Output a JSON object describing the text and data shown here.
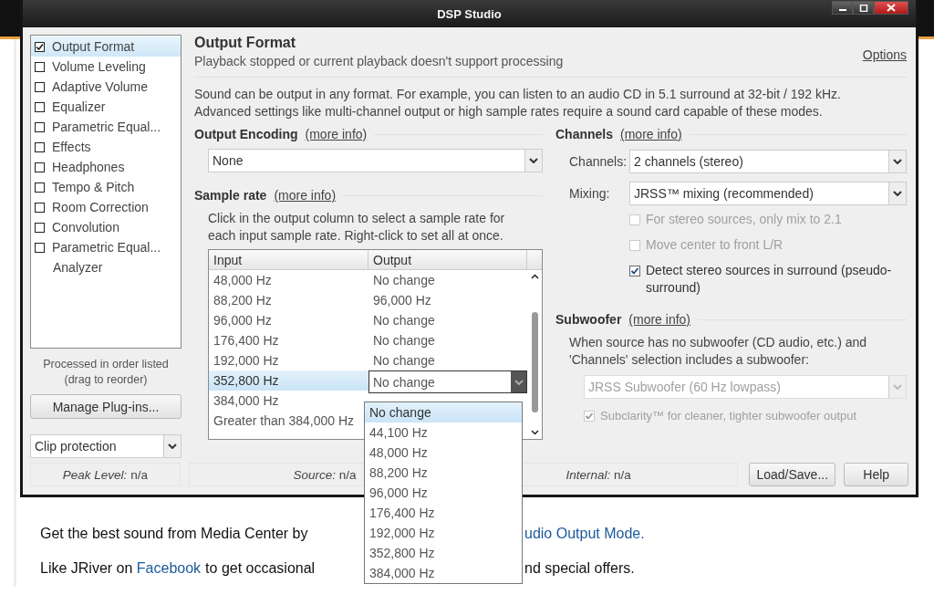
{
  "web_page": {
    "lines": [
      {
        "before": "Get the best sound from Media Center by",
        "link_after": "udio Output Mode."
      },
      {
        "before": "Like JRiver on ",
        "link_before": "Facebook",
        "after": "to get occasional",
        "tail": "nd special offers."
      }
    ]
  },
  "window": {
    "title": "DSP Studio"
  },
  "sidebar": {
    "items": [
      {
        "label": "Output Format",
        "kind": "check",
        "checked": true,
        "selected": true
      },
      {
        "label": "Volume Leveling",
        "kind": "check",
        "checked": false,
        "selected": false
      },
      {
        "label": "Adaptive Volume",
        "kind": "check",
        "checked": false,
        "selected": false
      },
      {
        "label": "Equalizer",
        "kind": "check",
        "checked": false,
        "selected": false
      },
      {
        "label": "Parametric Equal...",
        "kind": "check",
        "checked": false,
        "selected": false
      },
      {
        "label": "Effects",
        "kind": "check",
        "checked": false,
        "selected": false
      },
      {
        "label": "Headphones",
        "kind": "check",
        "checked": false,
        "selected": false
      },
      {
        "label": "Tempo & Pitch",
        "kind": "check",
        "checked": false,
        "selected": false
      },
      {
        "label": "Room Correction",
        "kind": "check",
        "checked": false,
        "selected": false
      },
      {
        "label": "Convolution",
        "kind": "check",
        "checked": false,
        "selected": false
      },
      {
        "label": "Parametric Equal...",
        "kind": "check",
        "checked": false,
        "selected": false
      },
      {
        "label": "Analyzer",
        "kind": "plain",
        "selected": false
      }
    ],
    "note_lines": [
      "Processed in order listed",
      "(drag to reorder)"
    ],
    "manage_button": "Manage Plug-ins...",
    "clip_select": "Clip protection"
  },
  "header": {
    "title": "Output Format",
    "subtitle": "Playback stopped or current playback doesn't support processing",
    "options_link": "Options"
  },
  "intro": [
    "Sound can be output in any format.  For example, you can listen to an audio CD in 5.1 surround at 32-bit / 192 kHz.",
    "Advanced settings like multi-channel output or high sample rates require a sound card capable of these modes."
  ],
  "output_encoding": {
    "heading": "Output Encoding",
    "more_info": "(more info)",
    "value": "None"
  },
  "sample_rate": {
    "heading": "Sample rate",
    "more_info": "(more info)",
    "help": [
      "Click in the output column to select a sample rate for",
      "each input sample rate.  Right-click to set all at once."
    ],
    "columns": [
      "Input",
      "Output"
    ],
    "rows": [
      {
        "input": "48,000 Hz",
        "output": "No change",
        "selected": false
      },
      {
        "input": "88,200 Hz",
        "output": "96,000 Hz",
        "selected": false
      },
      {
        "input": "96,000 Hz",
        "output": "No change",
        "selected": false
      },
      {
        "input": "176,400 Hz",
        "output": "No change",
        "selected": false
      },
      {
        "input": "192,000 Hz",
        "output": "No change",
        "selected": false
      },
      {
        "input": "352,800 Hz",
        "output": "No change",
        "selected": true
      },
      {
        "input": "384,000 Hz",
        "selected": false
      },
      {
        "input": "Greater than 384,000 Hz",
        "selected": false
      }
    ],
    "dropdown": [
      {
        "label": "No change",
        "selected": true
      },
      {
        "label": "44,100 Hz",
        "selected": false
      },
      {
        "label": "48,000 Hz",
        "selected": false
      },
      {
        "label": "88,200 Hz",
        "selected": false
      },
      {
        "label": "96,000 Hz",
        "selected": false
      },
      {
        "label": "176,400 Hz",
        "selected": false
      },
      {
        "label": "192,000 Hz",
        "selected": false
      },
      {
        "label": "352,800 Hz",
        "selected": false
      },
      {
        "label": "384,000 Hz",
        "selected": false
      }
    ]
  },
  "channels": {
    "heading": "Channels",
    "more_info": "(more info)",
    "fields": [
      {
        "label": "Channels:",
        "value": "2 channels (stereo)"
      },
      {
        "label": "Mixing:",
        "value": "JRSS™ mixing (recommended)"
      }
    ],
    "options": [
      {
        "label": "For stereo sources, only mix to 2.1",
        "checked": false,
        "disabled": true
      },
      {
        "label": "Move center to front L/R",
        "checked": false,
        "disabled": true
      },
      {
        "label": "Detect stereo sources in surround (pseudo-surround)",
        "checked": true,
        "disabled": false
      }
    ]
  },
  "subwoofer": {
    "heading": "Subwoofer",
    "more_info": "(more info)",
    "text": [
      "When source has no subwoofer (CD audio, etc.) and",
      "'Channels' selection includes a subwoofer:"
    ],
    "select": {
      "value": "JRSS Subwoofer (60 Hz lowpass)",
      "disabled": true
    },
    "option": {
      "label": "Subclarity™ for cleaner, tighter subwoofer output",
      "checked": true,
      "disabled": true
    }
  },
  "status_bar": {
    "peak": "*Peak Level:* n/a",
    "source": "*Source:* n/a",
    "internal": "*Internal:* n/a"
  },
  "buttons": [
    "Load/Save...",
    "Help"
  ]
}
